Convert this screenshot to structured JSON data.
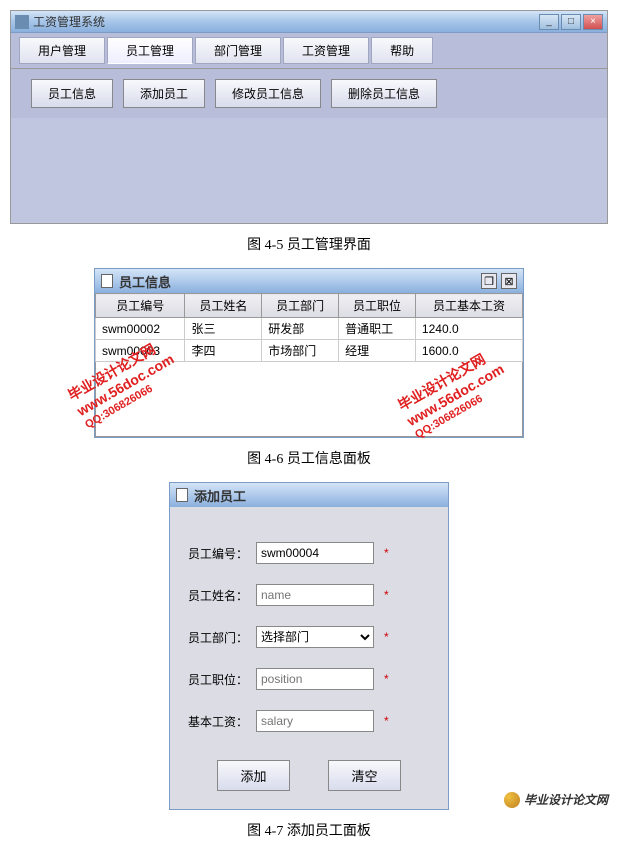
{
  "window1": {
    "title": "工资管理系统",
    "menu": [
      "用户管理",
      "员工管理",
      "部门管理",
      "工资管理",
      "帮助"
    ],
    "activeMenu": 1,
    "toolbar": [
      "员工信息",
      "添加员工",
      "修改员工信息",
      "删除员工信息"
    ]
  },
  "caption1": "图 4-5 员工管理界面",
  "window2": {
    "title": "员工信息",
    "columns": [
      "员工编号",
      "员工姓名",
      "员工部门",
      "员工职位",
      "员工基本工资"
    ],
    "rows": [
      [
        "swm00002",
        "张三",
        "研发部",
        "普通职工",
        "1240.0"
      ],
      [
        "swm00003",
        "李四",
        "市场部门",
        "经理",
        "1600.0"
      ]
    ]
  },
  "caption2": "图 4-6 员工信息面板",
  "window3": {
    "title": "添加员工",
    "fields": {
      "id": {
        "label": "员工编号：",
        "value": "swm00004"
      },
      "name": {
        "label": "员工姓名：",
        "placeholder": "name"
      },
      "dept": {
        "label": "员工部门：",
        "selected": "选择部门"
      },
      "position": {
        "label": "员工职位：",
        "placeholder": "position"
      },
      "salary": {
        "label": "基本工资：",
        "placeholder": "salary"
      }
    },
    "required": "*",
    "buttons": {
      "add": "添加",
      "clear": "清空"
    }
  },
  "caption3": "图 4-7 添加员工面板",
  "watermark": {
    "line1": "毕业设计论文网",
    "line2": "www.56doc.com",
    "line3": "QQ:306826066"
  },
  "footerLogo": "毕业设计论文网"
}
